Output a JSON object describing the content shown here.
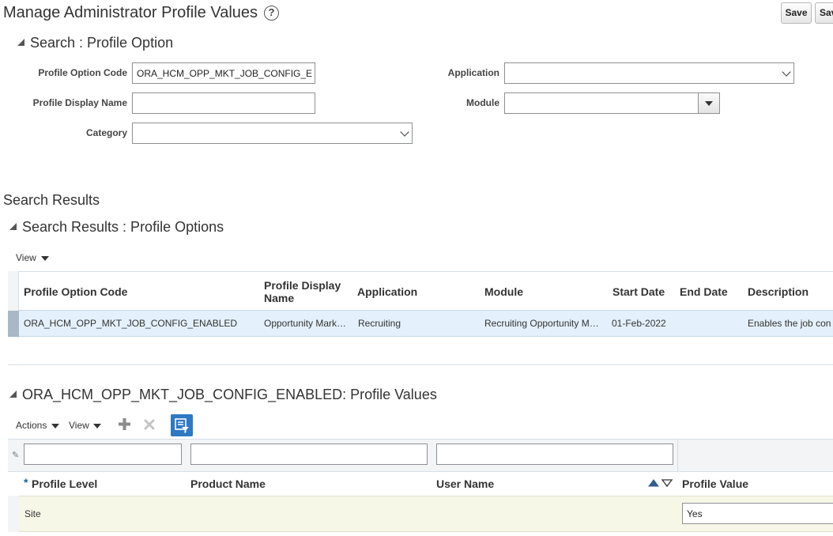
{
  "header": {
    "title": "Manage Administrator Profile Values",
    "save_label": "Save",
    "save_close_label_partial": "Sav"
  },
  "search": {
    "section_title": "Search : Profile Option",
    "fields": {
      "profile_option_code": {
        "label": "Profile Option Code",
        "value": "ORA_HCM_OPP_MKT_JOB_CONFIG_E"
      },
      "profile_display_name": {
        "label": "Profile Display Name",
        "value": ""
      },
      "category": {
        "label": "Category",
        "value": ""
      },
      "application": {
        "label": "Application",
        "value": ""
      },
      "module": {
        "label": "Module",
        "value": ""
      }
    }
  },
  "results": {
    "heading": "Search Results",
    "section_title": "Search Results : Profile Options",
    "view_label": "View",
    "columns": {
      "code": "Profile Option Code",
      "display_name_1": "Profile Display",
      "display_name_2": "Name",
      "application": "Application",
      "module": "Module",
      "start_date": "Start Date",
      "end_date": "End Date",
      "description": "Description"
    },
    "row": {
      "code": "ORA_HCM_OPP_MKT_JOB_CONFIG_ENABLED",
      "display_name": "Opportunity Mark…",
      "application": "Recruiting",
      "module": "Recruiting Opportunity M…",
      "start_date": "01-Feb-2022",
      "end_date": "",
      "description": "Enables the job con"
    }
  },
  "values": {
    "section_title": "ORA_HCM_OPP_MKT_JOB_CONFIG_ENABLED: Profile Values",
    "actions_label": "Actions",
    "view_label": "View",
    "required_marker": "*",
    "columns": {
      "profile_level": "Profile Level",
      "product_name": "Product Name",
      "user_name": "User Name",
      "profile_value": "Profile Value"
    },
    "row": {
      "profile_level": "Site",
      "product_name": "",
      "user_name": "",
      "profile_value": "Yes"
    }
  },
  "colors": {
    "selected_row": "#e4f0fb",
    "selected_row_marker": "#a9b8c6",
    "value_row": "#f7f7e8",
    "accent_button": "#2e79c4"
  }
}
